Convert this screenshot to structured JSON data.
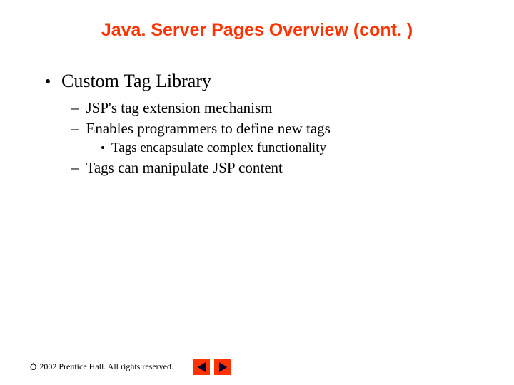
{
  "title": "Java. Server Pages Overview (cont. )",
  "bullets": {
    "l1": "Custom Tag Library",
    "l2a": "JSP's tag extension mechanism",
    "l2b": "Enables programmers to define new tags",
    "l3a": "Tags encapsulate complex functionality",
    "l2c": "Tags can manipulate JSP content"
  },
  "footer": {
    "copyright_symbol": "Ó",
    "text": " 2002 Prentice Hall. All rights reserved."
  }
}
